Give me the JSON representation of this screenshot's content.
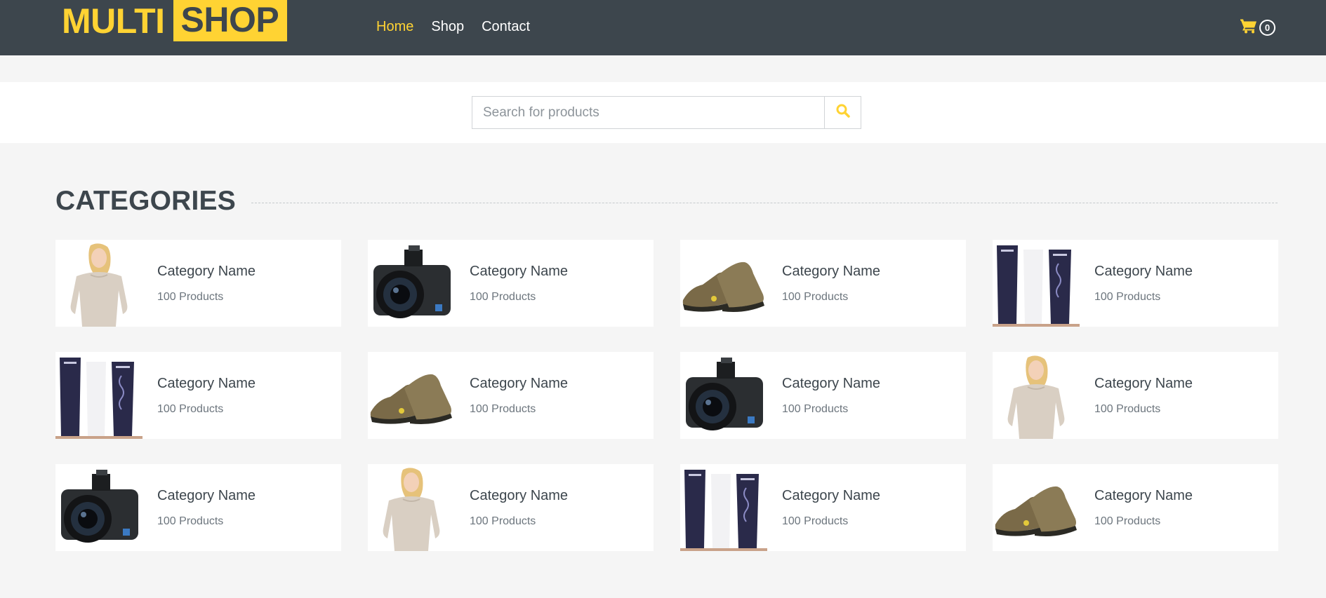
{
  "brand": {
    "part1": "MULTI",
    "part2": "SHOP"
  },
  "nav": {
    "links": [
      {
        "label": "Home",
        "active": true
      },
      {
        "label": "Shop",
        "active": false
      },
      {
        "label": "Contact",
        "active": false
      }
    ],
    "cart_count": "0"
  },
  "search": {
    "placeholder": "Search for products",
    "icon": "search-icon"
  },
  "categories": {
    "title": "CATEGORIES",
    "items": [
      {
        "image": "woman-sweater",
        "name": "Category Name",
        "count": "100 Products"
      },
      {
        "image": "camera",
        "name": "Category Name",
        "count": "100 Products"
      },
      {
        "image": "shoes",
        "name": "Category Name",
        "count": "100 Products"
      },
      {
        "image": "cosmetics",
        "name": "Category Name",
        "count": "100 Products"
      },
      {
        "image": "cosmetics",
        "name": "Category Name",
        "count": "100 Products"
      },
      {
        "image": "shoes",
        "name": "Category Name",
        "count": "100 Products"
      },
      {
        "image": "camera",
        "name": "Category Name",
        "count": "100 Products"
      },
      {
        "image": "woman-sweater",
        "name": "Category Name",
        "count": "100 Products"
      },
      {
        "image": "camera",
        "name": "Category Name",
        "count": "100 Products"
      },
      {
        "image": "woman-sweater",
        "name": "Category Name",
        "count": "100 Products"
      },
      {
        "image": "cosmetics",
        "name": "Category Name",
        "count": "100 Products"
      },
      {
        "image": "shoes",
        "name": "Category Name",
        "count": "100 Products"
      }
    ]
  },
  "colors": {
    "accent": "#ffd333",
    "dark": "#3d464d",
    "background": "#f5f5f5"
  }
}
